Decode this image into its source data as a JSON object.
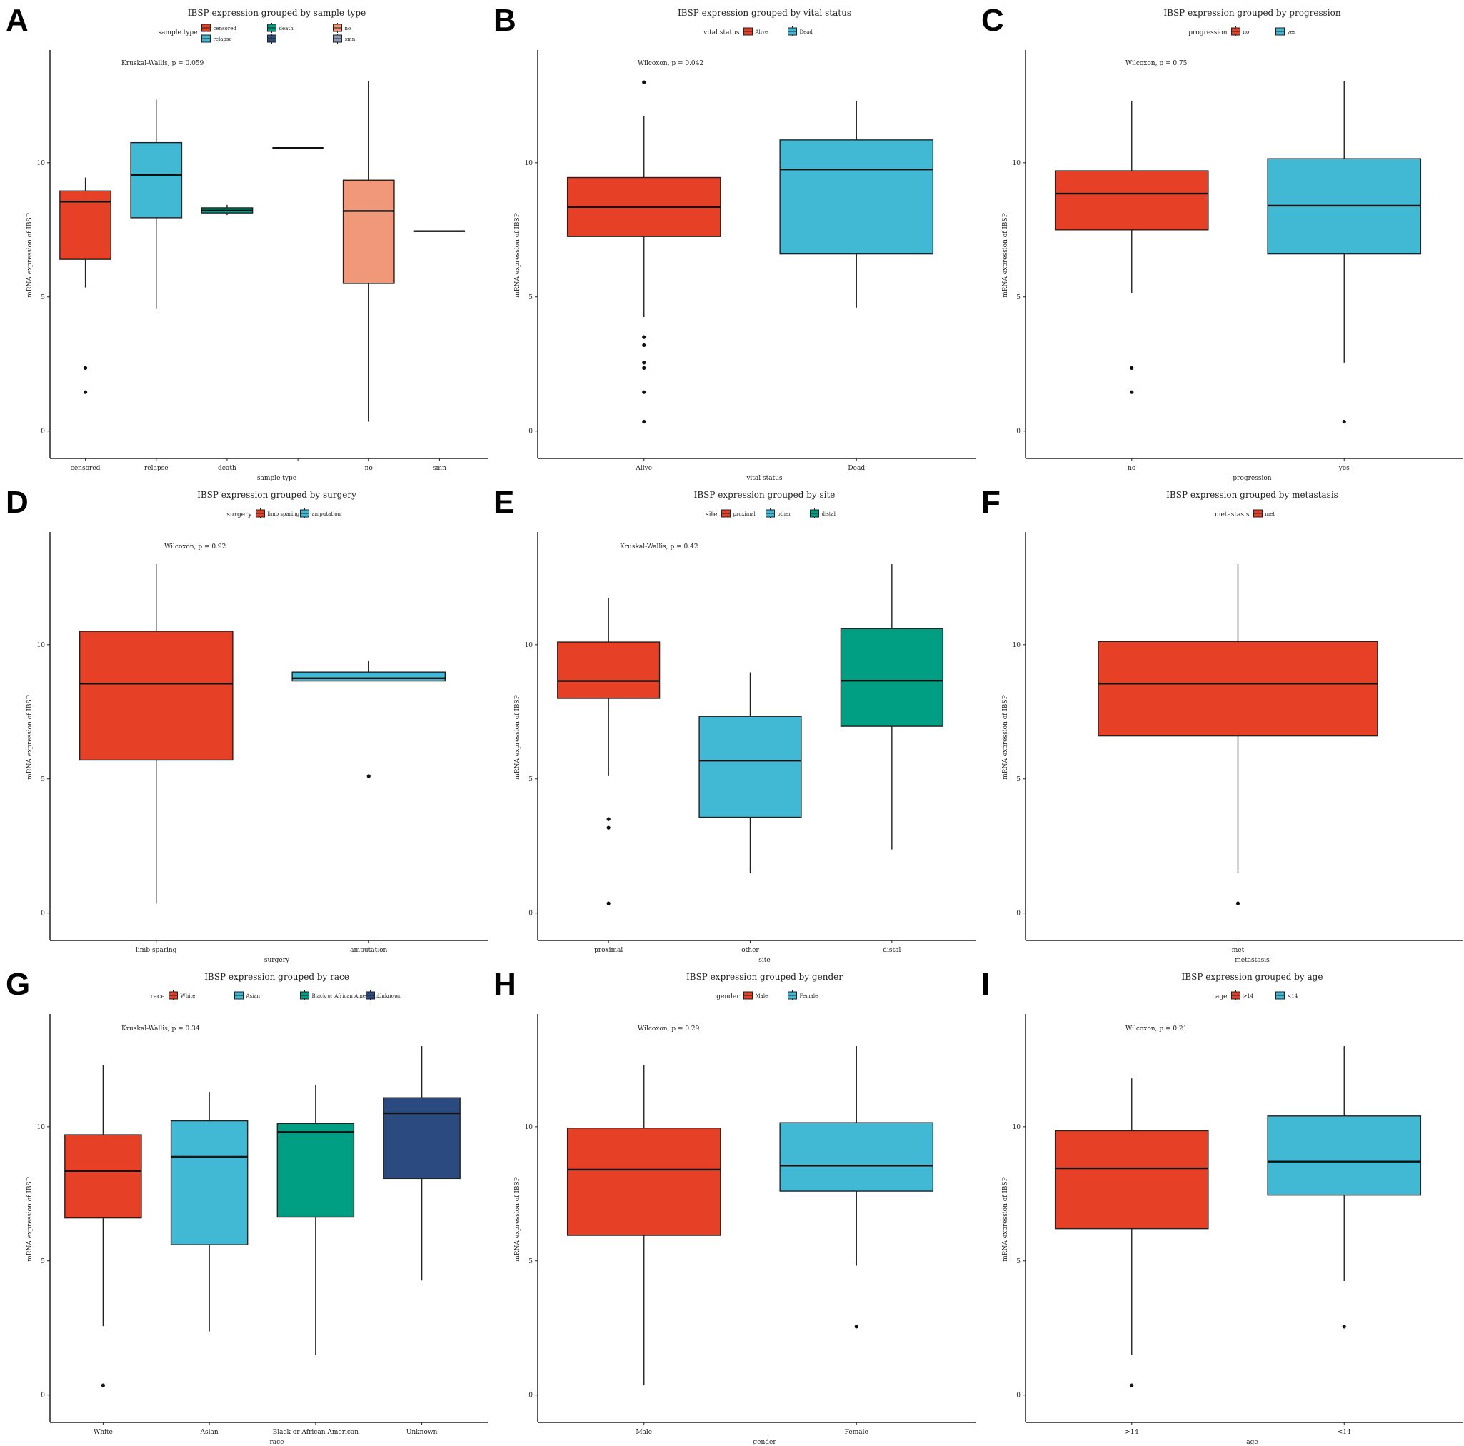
{
  "colors": {
    "red": "#E64027",
    "cyan": "#42B9D4",
    "teal": "#009E82",
    "navy": "#2A4A80",
    "salmon": "#F2987A",
    "slate": "#8E9BB5"
  },
  "ylabel": "mRNA expression of IBSP",
  "chart_data": [
    {
      "panel": "A",
      "type": "box",
      "title": "IBSP expression grouped by sample type",
      "legend_title": "sample type",
      "legend": [
        {
          "label": "censored",
          "color": "#E64027"
        },
        {
          "label": "death",
          "color": "#009E82"
        },
        {
          "label": "no",
          "color": "#F2987A"
        },
        {
          "label": "relapse",
          "color": "#42B9D4"
        },
        {
          "label": "",
          "color": "#2A4A80"
        },
        {
          "label": "smn",
          "color": "#8E9BB5"
        }
      ],
      "legend_columns": 3,
      "annotation": "Kruskal-Wallis, p = 0.059",
      "xlabel": "sample type",
      "ylabel": "mRNA expression of IBSP",
      "ylim": [
        -0.7,
        13.8
      ],
      "yticks": [
        0,
        5,
        10
      ],
      "categories": [
        "censored",
        "relapse",
        "death",
        "",
        "no",
        "smn"
      ],
      "boxes": [
        {
          "category": "censored",
          "color": "#E64027",
          "whisker_low": 5.35,
          "q1": 6.4,
          "median": 8.55,
          "q3": 8.95,
          "whisker_high": 9.45,
          "outliers": [
            2.35,
            1.45
          ]
        },
        {
          "category": "relapse",
          "color": "#42B9D4",
          "whisker_low": 4.55,
          "q1": 7.95,
          "median": 9.55,
          "q3": 10.75,
          "whisker_high": 12.35,
          "outliers": []
        },
        {
          "category": "death",
          "color": "#009E82",
          "whisker_low": 8.05,
          "q1": 8.13,
          "median": 8.22,
          "q3": 8.32,
          "whisker_high": 8.43,
          "outliers": []
        },
        {
          "category": "",
          "color": "#2A4A80",
          "whisker_low": 10.55,
          "q1": 10.55,
          "median": 10.55,
          "q3": 10.55,
          "whisker_high": 10.55,
          "outliers": []
        },
        {
          "category": "no",
          "color": "#F2987A",
          "whisker_low": 0.35,
          "q1": 5.5,
          "median": 8.2,
          "q3": 9.35,
          "whisker_high": 13.05,
          "outliers": []
        },
        {
          "category": "smn",
          "color": "#8E9BB5",
          "whisker_low": 7.45,
          "q1": 7.45,
          "median": 7.45,
          "q3": 7.45,
          "whisker_high": 7.45,
          "outliers": []
        }
      ]
    },
    {
      "panel": "B",
      "type": "box",
      "title": "IBSP expression grouped by vital status",
      "legend_title": "vital status",
      "legend": [
        {
          "label": "Alive",
          "color": "#E64027"
        },
        {
          "label": "Dead",
          "color": "#42B9D4"
        }
      ],
      "legend_columns": 2,
      "annotation": "Wilcoxon, p = 0.042",
      "xlabel": "vital status",
      "ylabel": "mRNA expression of IBSP",
      "ylim": [
        -0.7,
        13.8
      ],
      "yticks": [
        0,
        5,
        10
      ],
      "categories": [
        "Alive",
        "Dead"
      ],
      "boxes": [
        {
          "category": "Alive",
          "color": "#E64027",
          "whisker_low": 4.25,
          "q1": 7.25,
          "median": 8.35,
          "q3": 9.45,
          "whisker_high": 11.75,
          "outliers": [
            13.0,
            3.5,
            3.2,
            2.55,
            2.35,
            1.45,
            0.35
          ]
        },
        {
          "category": "Dead",
          "color": "#42B9D4",
          "whisker_low": 4.6,
          "q1": 6.6,
          "median": 9.75,
          "q3": 10.85,
          "whisker_high": 12.3,
          "outliers": []
        }
      ]
    },
    {
      "panel": "C",
      "type": "box",
      "title": "IBSP expression grouped by progression",
      "legend_title": "progression",
      "legend": [
        {
          "label": "no",
          "color": "#E64027"
        },
        {
          "label": "yes",
          "color": "#42B9D4"
        }
      ],
      "legend_columns": 2,
      "annotation": "Wilcoxon, p = 0.75",
      "xlabel": "progression",
      "ylabel": "mRNA expression of IBSP",
      "ylim": [
        -0.7,
        13.8
      ],
      "yticks": [
        0,
        5,
        10
      ],
      "categories": [
        "no",
        "yes"
      ],
      "boxes": [
        {
          "category": "no",
          "color": "#E64027",
          "whisker_low": 5.15,
          "q1": 7.5,
          "median": 8.85,
          "q3": 9.7,
          "whisker_high": 12.3,
          "outliers": [
            2.35,
            1.45
          ]
        },
        {
          "category": "yes",
          "color": "#42B9D4",
          "whisker_low": 2.55,
          "q1": 6.6,
          "median": 8.4,
          "q3": 10.15,
          "whisker_high": 13.05,
          "outliers": [
            0.35
          ]
        }
      ]
    },
    {
      "panel": "D",
      "type": "box",
      "title": "IBSP expression grouped by surgery",
      "legend_title": "surgery",
      "legend": [
        {
          "label": "limb sparing",
          "color": "#E64027"
        },
        {
          "label": "amputation",
          "color": "#42B9D4"
        }
      ],
      "legend_columns": 2,
      "annotation": "Wilcoxon, p = 0.92",
      "xlabel": "surgery",
      "ylabel": "mRNA expression of IBSP",
      "ylim": [
        -0.7,
        13.8
      ],
      "yticks": [
        0,
        5,
        10
      ],
      "categories": [
        "limb sparing",
        "amputation"
      ],
      "boxes": [
        {
          "category": "limb sparing",
          "color": "#E64027",
          "whisker_low": 0.35,
          "q1": 5.7,
          "median": 8.55,
          "q3": 10.5,
          "whisker_high": 13.0,
          "outliers": []
        },
        {
          "category": "amputation",
          "color": "#42B9D4",
          "whisker_low": 8.65,
          "q1": 8.65,
          "median": 8.75,
          "q3": 8.98,
          "whisker_high": 9.4,
          "outliers": [
            5.1
          ]
        }
      ]
    },
    {
      "panel": "E",
      "type": "box",
      "title": "IBSP expression grouped by site",
      "legend_title": "site",
      "legend": [
        {
          "label": "proximal",
          "color": "#E64027"
        },
        {
          "label": "other",
          "color": "#42B9D4"
        },
        {
          "label": "distal",
          "color": "#009E82"
        }
      ],
      "legend_columns": 3,
      "annotation": "Kruskal-Wallis, p = 0.42",
      "xlabel": "site",
      "ylabel": "mRNA expression of IBSP",
      "ylim": [
        -0.7,
        13.8
      ],
      "yticks": [
        0,
        5,
        10
      ],
      "categories": [
        "proximal",
        "other",
        "distal"
      ],
      "boxes": [
        {
          "category": "proximal",
          "color": "#E64027",
          "whisker_low": 5.1,
          "q1": 8.0,
          "median": 8.65,
          "q3": 10.1,
          "whisker_high": 11.75,
          "outliers": [
            3.5,
            3.18,
            0.36
          ]
        },
        {
          "category": "other",
          "color": "#42B9D4",
          "whisker_low": 1.48,
          "q1": 3.57,
          "median": 5.68,
          "q3": 7.33,
          "whisker_high": 8.97,
          "outliers": []
        },
        {
          "category": "distal",
          "color": "#009E82",
          "whisker_low": 2.37,
          "q1": 6.96,
          "median": 8.66,
          "q3": 10.6,
          "whisker_high": 13.0,
          "outliers": []
        }
      ]
    },
    {
      "panel": "F",
      "type": "box",
      "title": "IBSP expression grouped by metastasis",
      "legend_title": "metastasis",
      "legend": [
        {
          "label": "met",
          "color": "#E64027"
        }
      ],
      "legend_columns": 1,
      "annotation": "",
      "xlabel": "metastasis",
      "ylabel": "mRNA expression of IBSP",
      "ylim": [
        -0.7,
        13.8
      ],
      "yticks": [
        0,
        5,
        10
      ],
      "categories": [
        "met"
      ],
      "boxes": [
        {
          "category": "met",
          "color": "#E64027",
          "whisker_low": 1.5,
          "q1": 6.6,
          "median": 8.55,
          "q3": 10.12,
          "whisker_high": 13.0,
          "outliers": [
            0.36
          ]
        }
      ]
    },
    {
      "panel": "G",
      "type": "box",
      "title": "IBSP expression grouped by race",
      "legend_title": "race",
      "legend": [
        {
          "label": "White",
          "color": "#E64027"
        },
        {
          "label": "Asian",
          "color": "#42B9D4"
        },
        {
          "label": "Black or African American",
          "color": "#009E82"
        },
        {
          "label": "Unknown",
          "color": "#2A4A80"
        }
      ],
      "legend_columns": 4,
      "annotation": "Kruskal-Wallis, p = 0.34",
      "xlabel": "race",
      "ylabel": "mRNA expression of IBSP",
      "ylim": [
        -0.7,
        13.8
      ],
      "yticks": [
        0,
        5,
        10
      ],
      "categories": [
        "White",
        "Asian",
        "Black or African American",
        "Unknown"
      ],
      "boxes": [
        {
          "category": "White",
          "color": "#E64027",
          "whisker_low": 2.57,
          "q1": 6.6,
          "median": 8.35,
          "q3": 9.7,
          "whisker_high": 12.3,
          "outliers": [
            0.36
          ]
        },
        {
          "category": "Asian",
          "color": "#42B9D4",
          "whisker_low": 2.37,
          "q1": 5.6,
          "median": 8.88,
          "q3": 10.22,
          "whisker_high": 11.3,
          "outliers": []
        },
        {
          "category": "Black or African American",
          "color": "#009E82",
          "whisker_low": 1.48,
          "q1": 6.63,
          "median": 9.8,
          "q3": 10.12,
          "whisker_high": 11.55,
          "outliers": []
        },
        {
          "category": "Unknown",
          "color": "#2A4A80",
          "whisker_low": 4.27,
          "q1": 8.07,
          "median": 10.5,
          "q3": 11.08,
          "whisker_high": 13.0,
          "outliers": []
        }
      ]
    },
    {
      "panel": "H",
      "type": "box",
      "title": "IBSP expression grouped by gender",
      "legend_title": "gender",
      "legend": [
        {
          "label": "Male",
          "color": "#E64027"
        },
        {
          "label": "Female",
          "color": "#42B9D4"
        }
      ],
      "legend_columns": 2,
      "annotation": "Wilcoxon, p = 0.29",
      "xlabel": "gender",
      "ylabel": "mRNA expression of IBSP",
      "ylim": [
        -0.7,
        13.8
      ],
      "yticks": [
        0,
        5,
        10
      ],
      "categories": [
        "Male",
        "Female"
      ],
      "boxes": [
        {
          "category": "Male",
          "color": "#E64027",
          "whisker_low": 0.36,
          "q1": 5.95,
          "median": 8.4,
          "q3": 9.95,
          "whisker_high": 12.3,
          "outliers": []
        },
        {
          "category": "Female",
          "color": "#42B9D4",
          "whisker_low": 4.82,
          "q1": 7.6,
          "median": 8.55,
          "q3": 10.15,
          "whisker_high": 13.0,
          "outliers": [
            2.55
          ]
        }
      ]
    },
    {
      "panel": "I",
      "type": "box",
      "title": "IBSP expression grouped by age",
      "legend_title": "age",
      "legend": [
        {
          "label": ">14",
          "color": "#E64027"
        },
        {
          "label": "<14",
          "color": "#42B9D4"
        }
      ],
      "legend_columns": 2,
      "annotation": "Wilcoxon, p = 0.21",
      "xlabel": "age",
      "ylabel": "mRNA expression of IBSP",
      "ylim": [
        -0.7,
        13.8
      ],
      "yticks": [
        0,
        5,
        10
      ],
      "categories": [
        ">14",
        "<14"
      ],
      "boxes": [
        {
          "category": ">14",
          "color": "#E64027",
          "whisker_low": 1.5,
          "q1": 6.2,
          "median": 8.45,
          "q3": 9.85,
          "whisker_high": 11.8,
          "outliers": [
            0.36
          ]
        },
        {
          "category": "<14",
          "color": "#42B9D4",
          "whisker_low": 4.25,
          "q1": 7.45,
          "median": 8.7,
          "q3": 10.4,
          "whisker_high": 13.0,
          "outliers": [
            2.55
          ]
        }
      ]
    }
  ]
}
